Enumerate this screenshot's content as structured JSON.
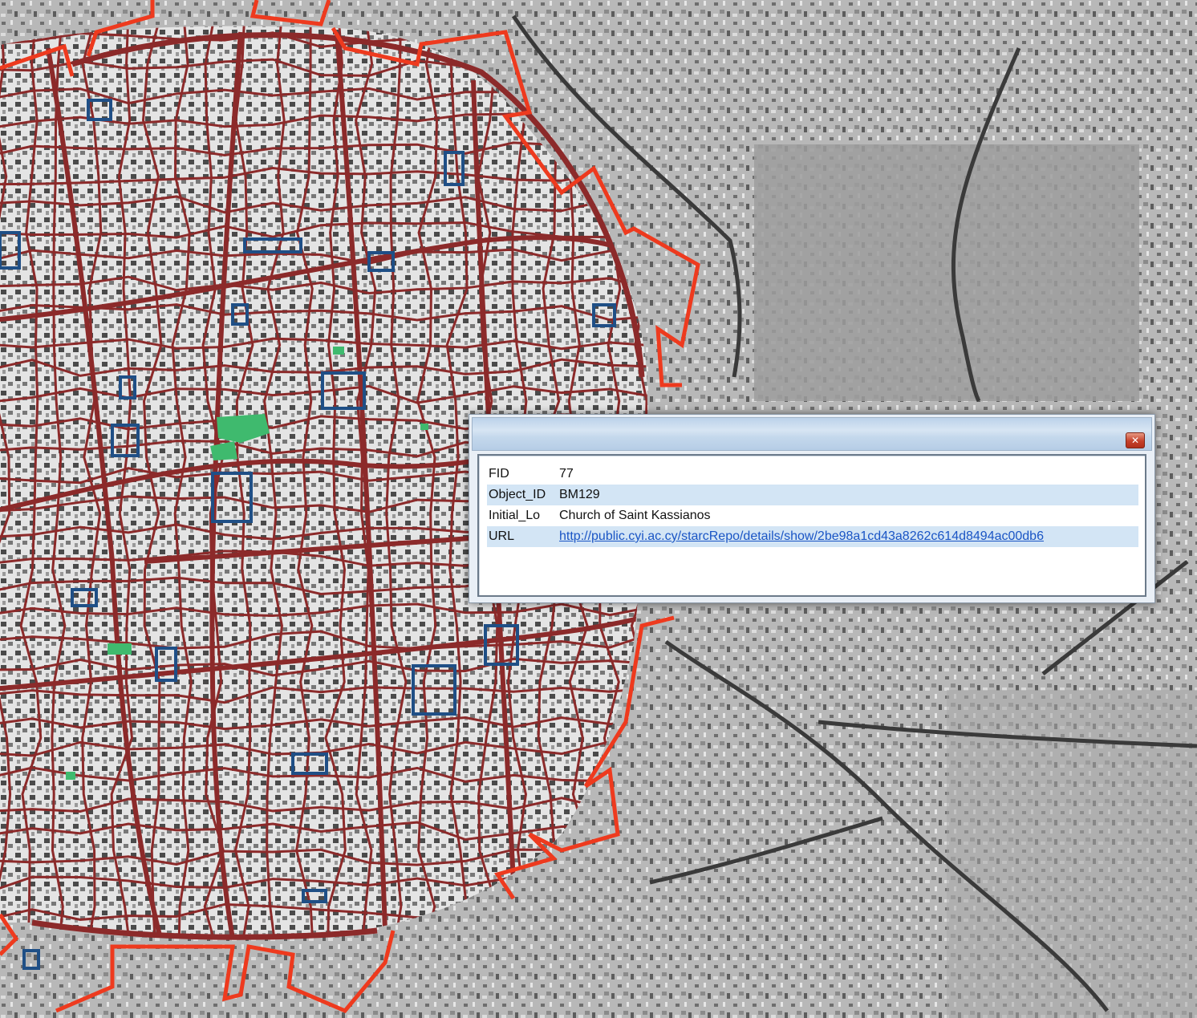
{
  "map": {
    "basemap": "greyscale aerial photograph",
    "colors": {
      "streets": "#8c2a2a",
      "city_walls": "#ee3a1e",
      "monuments": "#1f4f86",
      "green_areas": "#3fba6e"
    }
  },
  "popup": {
    "close_icon": "close-icon",
    "close_glyph": "✕",
    "rows": [
      {
        "field": "FID",
        "value": "77"
      },
      {
        "field": "Object_ID",
        "value": "BM129"
      },
      {
        "field": "Initial_Lo",
        "value": "Church of Saint Kassianos"
      },
      {
        "field": "URL",
        "value": "http://public.cyi.ac.cy/starcRepo/details/show/2be98a1cd43a8262c614d8494ac00db6"
      }
    ]
  }
}
